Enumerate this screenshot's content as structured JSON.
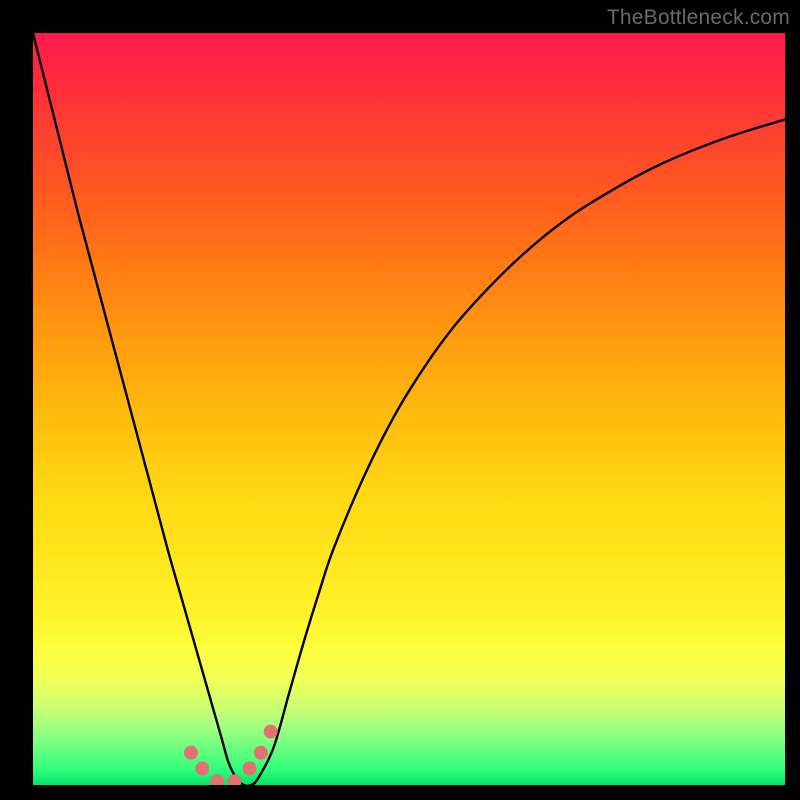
{
  "watermark": "TheBottleneck.com",
  "colors": {
    "frame": "#000000",
    "curve": "#000000",
    "marker": "#e0726f",
    "gradient_top": "#ff1a4d",
    "gradient_bottom": "#05e26a"
  },
  "chart_data": {
    "type": "line",
    "title": "",
    "xlabel": "",
    "ylabel": "",
    "xlim": [
      0,
      100
    ],
    "ylim": [
      0,
      100
    ],
    "x": [
      0,
      2,
      4,
      6,
      8,
      10,
      12,
      14,
      16,
      18,
      20,
      21,
      22,
      23,
      24,
      25,
      26,
      27,
      28,
      29,
      30,
      32,
      34,
      36,
      38,
      40,
      44,
      48,
      52,
      56,
      60,
      64,
      68,
      72,
      76,
      80,
      84,
      88,
      92,
      96,
      100
    ],
    "y": [
      100,
      92,
      84,
      76,
      68.5,
      61,
      53.5,
      46,
      38.5,
      31,
      24,
      20.5,
      17,
      13.5,
      10,
      6.5,
      3,
      1,
      0,
      0,
      1,
      5,
      12,
      19,
      25.5,
      31.5,
      41,
      49,
      55.5,
      61,
      65.5,
      69.5,
      73,
      76,
      78.5,
      80.8,
      82.8,
      84.5,
      86,
      87.3,
      88.5
    ],
    "markers": {
      "x": [
        21.0,
        22.5,
        24.5,
        26.8,
        28.8,
        30.3,
        31.6
      ],
      "y": [
        4.3,
        2.2,
        0.5,
        0.5,
        2.2,
        4.3,
        7.1
      ]
    },
    "annotations": [],
    "axes_visible": false,
    "background_gradient": "vertical red→orange→yellow→green"
  }
}
